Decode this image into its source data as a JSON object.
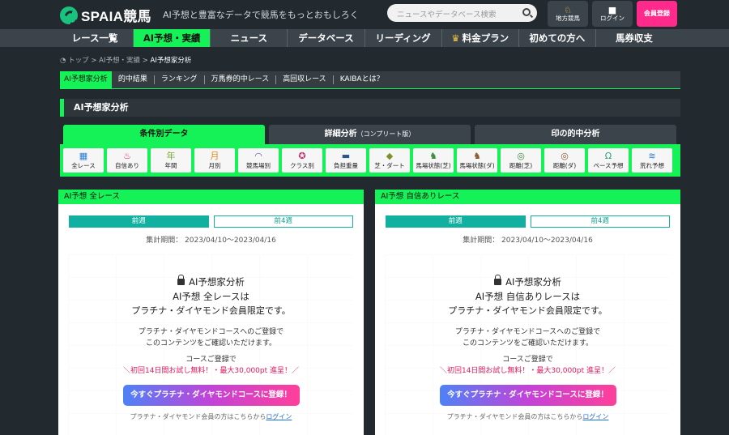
{
  "header": {
    "logo": "SPAIA競馬",
    "tagline": "AI予想と豊富なデータで競馬をもっとおもしろく",
    "search_placeholder": "ニュースやデータベース検索",
    "buttons": [
      {
        "label": "地方競馬",
        "icon": "horse-icon"
      },
      {
        "label": "ログイン",
        "icon": "lock-icon"
      },
      {
        "label": "会員登録",
        "icon": ""
      }
    ]
  },
  "nav": {
    "items": [
      "レース一覧",
      "AI予想・実績",
      "ニュース",
      "データベース",
      "リーディング",
      "料金プラン",
      "初めての方へ",
      "馬券収支"
    ],
    "active_index": 1
  },
  "breadcrumb": {
    "items": [
      "トップ",
      "AI予想・実績"
    ],
    "current": "AI予想家分析",
    "separator": ">"
  },
  "subnav": {
    "items": [
      "AI予想家分析",
      "的中結果",
      "ランキング",
      "万馬券的中レース",
      "高回収レース",
      "KAIBAとは？"
    ]
  },
  "section_title": "AI予想家分析",
  "tabs": [
    {
      "label": "条件別データ",
      "note": ""
    },
    {
      "label": "詳細分析",
      "note": "（コンプリート版）"
    },
    {
      "label": "印の的中分析",
      "note": ""
    }
  ],
  "filters": [
    {
      "label": "全レース",
      "icon": "grid-icon",
      "glyph": "▦",
      "color": "#2a7fd4"
    },
    {
      "label": "自信あり",
      "icon": "flame-icon",
      "glyph": "♨",
      "color": "#e0195d"
    },
    {
      "label": "年間",
      "icon": "calendar-year-icon",
      "glyph": "年",
      "color": "#7aa83a"
    },
    {
      "label": "月別",
      "icon": "calendar-month-icon",
      "glyph": "月",
      "color": "#e08a1e"
    },
    {
      "label": "競馬場別",
      "icon": "stadium-icon",
      "glyph": "◠",
      "color": "#6a4fb3"
    },
    {
      "label": "クラス別",
      "icon": "medal-icon",
      "glyph": "✪",
      "color": "#c0306b"
    },
    {
      "label": "負担重量",
      "icon": "weight-icon",
      "glyph": "▬",
      "color": "#25588e"
    },
    {
      "label": "芝・ダート",
      "icon": "turf-dirt-icon",
      "glyph": "◆",
      "color": "#7b8f2a"
    },
    {
      "label": "馬場状態(芝)",
      "icon": "turf-condition-icon",
      "glyph": "♞",
      "color": "#3c8a3c"
    },
    {
      "label": "馬場状態(ダ)",
      "icon": "dirt-condition-icon",
      "glyph": "♞",
      "color": "#8a5a2a"
    },
    {
      "label": "距離(芝)",
      "icon": "distance-turf-icon",
      "glyph": "◎",
      "color": "#3c8a3c"
    },
    {
      "label": "距離(ダ)",
      "icon": "distance-dirt-icon",
      "glyph": "◎",
      "color": "#8a5a2a"
    },
    {
      "label": "ペース予想",
      "icon": "horseshoe-icon",
      "glyph": "Ω",
      "color": "#2c9d7c"
    },
    {
      "label": "荒れ予想",
      "icon": "wave-icon",
      "glyph": "≋",
      "color": "#2a7fd4"
    }
  ],
  "cards": [
    {
      "header": "AI予想 全レース",
      "week_current": "前週",
      "week_past": "前4週",
      "period": "集計期間： 2023/04/10～2023/04/16",
      "lock_title": "AI予想家分析",
      "lock_subject": "AI予想 全レースは",
      "lock_restriction": "プラチナ・ダイヤモンド会員限定です。",
      "lock_info_1": "プラチナ・ダイヤモンドコースへのご登録で",
      "lock_info_2": "このコンテンツをご確認いただけます。",
      "lock_promo_1": "コースご登録で",
      "lock_promo_2": "＼初回14日間お試し無料！・最大30,000pt 進呈！／",
      "cta": "今すぐプラチナ・ダイヤモンドコースに登録！",
      "footer_text": "プラチナ・ダイヤモンド会員の方はこちらから",
      "footer_link": "ログイン"
    },
    {
      "header": "AI予想 自信ありレース",
      "week_current": "前週",
      "week_past": "前4週",
      "period": "集計期間： 2023/04/10～2023/04/16",
      "lock_title": "AI予想家分析",
      "lock_subject": "AI予想 自信ありレースは",
      "lock_restriction": "プラチナ・ダイヤモンド会員限定です。",
      "lock_info_1": "プラチナ・ダイヤモンドコースへのご登録で",
      "lock_info_2": "このコンテンツをご確認いただけます。",
      "lock_promo_1": "コースご登録で",
      "lock_promo_2": "＼初回14日間お試し無料！・最大30,000pt 進呈！／",
      "cta": "今すぐプラチナ・ダイヤモンドコースに登録！",
      "footer_text": "プラチナ・ダイヤモンド会員の方はこちらから",
      "footer_link": "ログイン"
    }
  ],
  "colors": {
    "accent": "#14f257",
    "header_bg": "#222a30",
    "nav_bg": "#3b444b",
    "teal": "#12b0a0",
    "promo_red": "#e0195d",
    "register_pink": "#ff2a8c"
  }
}
